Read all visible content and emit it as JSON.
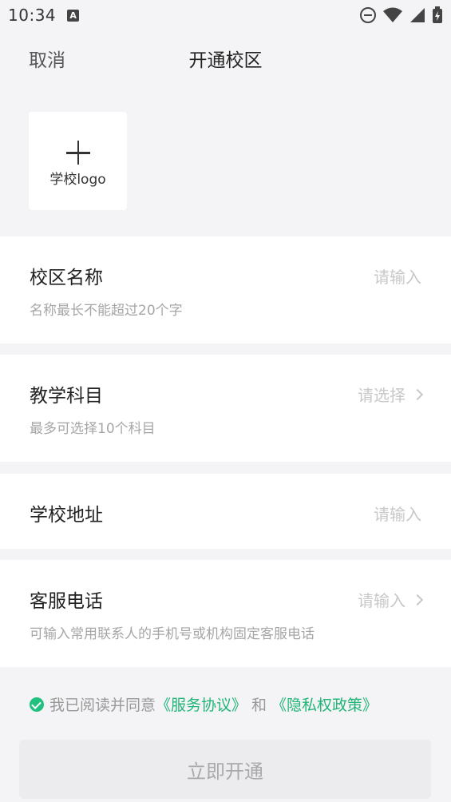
{
  "status_bar": {
    "time": "10:34",
    "notification_icon_letter": "A",
    "icons": [
      "a-notification-icon",
      "dnd-icon",
      "wifi-icon",
      "signal-icon",
      "battery-charging-icon"
    ]
  },
  "nav": {
    "cancel_label": "取消",
    "title": "开通校区"
  },
  "logo_upload": {
    "icon": "plus-icon",
    "label": "学校logo"
  },
  "fields": {
    "campus_name": {
      "label": "校区名称",
      "placeholder": "请输入",
      "hint": "名称最长不能超过20个字"
    },
    "subjects": {
      "label": "教学科目",
      "placeholder": "请选择",
      "hint": "最多可选择10个科目"
    },
    "address": {
      "label": "学校地址",
      "placeholder": "请输入"
    },
    "phone": {
      "label": "客服电话",
      "placeholder": "请输入",
      "hint": "可输入常用联系人的手机号或机构固定客服电话"
    }
  },
  "agreement": {
    "prefix": "我已阅读并同意",
    "service_link": "《服务协议》",
    "and": "和",
    "privacy_link": "《隐私权政策》",
    "checked": true
  },
  "submit_label": "立即开通",
  "colors": {
    "accent_green": "#20b577",
    "background": "#f4f4f6",
    "placeholder": "#c8c8c8",
    "hint": "#a6a6a6",
    "button_disabled_bg": "#ececee"
  }
}
